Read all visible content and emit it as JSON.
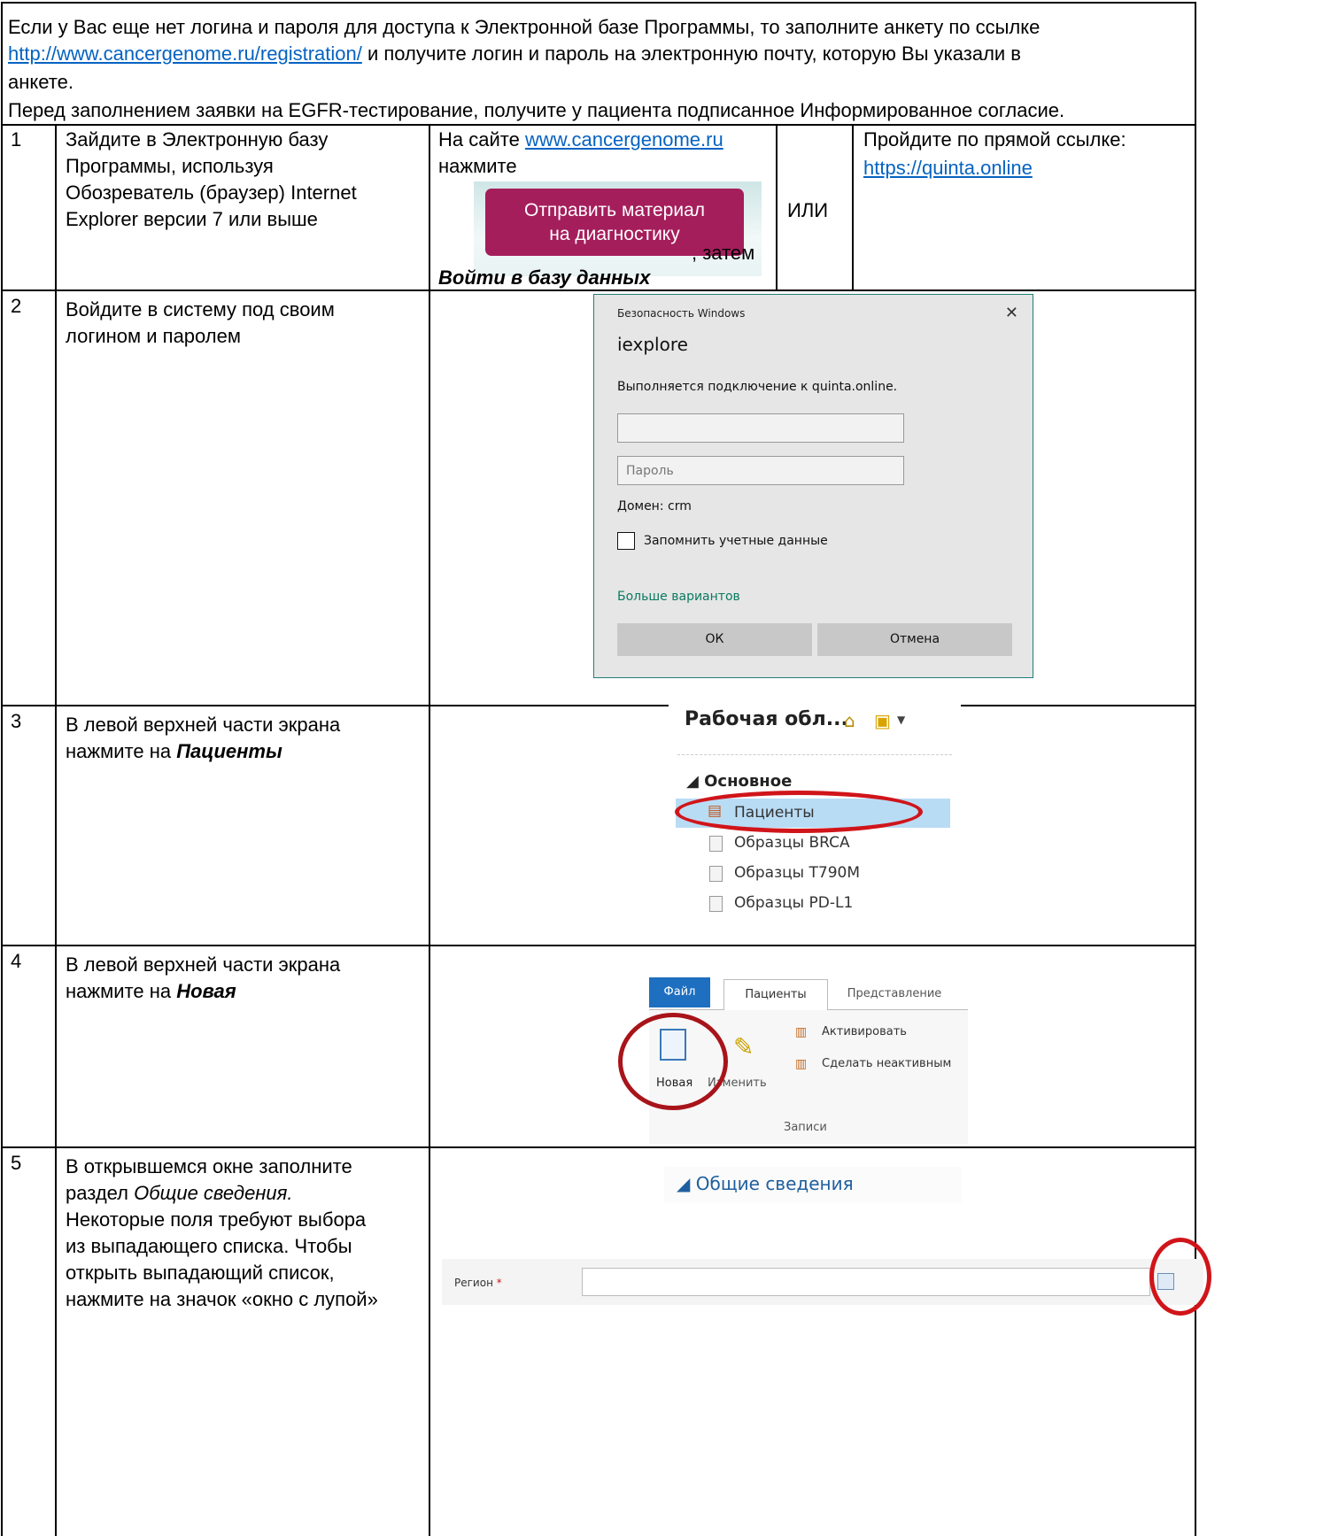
{
  "intro": {
    "line1": "Если у Вас еще нет логина и пароля для доступа к Электронной базе Программы, то заполните анкету по ссылке",
    "link": "http://www.cancergenome.ru/registration/",
    "line2_rest": " и получите логин и пароль на электронную почту, которую Вы указали в",
    "line3": "анкете.",
    "line4": "Перед заполнением заявки на EGFR-тестирование, получите у пациента подписанное Информированное согласие."
  },
  "rows": [
    {
      "num": "1",
      "text_lines": [
        "Зайдите в Электронную базу",
        "Программы, используя",
        "Обозреватель (браузер) Internet",
        "Explorer версии 7 или выше"
      ]
    },
    {
      "num": "2",
      "text_lines": [
        "Войдите в систему под своим",
        "логином и паролем"
      ]
    },
    {
      "num": "3",
      "text_lines": [
        "В левой верхней части экрана",
        "нажмите на "
      ],
      "bold": "Пациенты"
    },
    {
      "num": "4",
      "text_lines": [
        "В левой верхней части экрана",
        "нажмите на "
      ],
      "bold": "Новая"
    },
    {
      "num": "5",
      "text_lines": [
        "В открывшемся окне заполните",
        "раздел ",
        "Некоторые поля требуют выбора",
        "из выпадающего списка. Чтобы",
        "открыть выпадающий список,",
        "нажмите на значок «окно с лупой»"
      ],
      "italic": "Общие сведения."
    }
  ],
  "step1": {
    "site_prefix": "На сайте ",
    "site_link": "www.cancergenome.ru",
    "press": "нажмите",
    "button_line1": "Отправить материал",
    "button_line2": "на диагностику",
    "then": ", затем",
    "login_bold": "Войти в базу данных",
    "or": "ИЛИ",
    "direct": "Пройдите по прямой ссылке:",
    "direct_link": "https://quinta.online"
  },
  "dialog": {
    "title": "Безопасность Windows",
    "close": "✕",
    "app": "iexplore",
    "connecting": "Выполняется подключение к quinta.online.",
    "password_placeholder": "Пароль",
    "domain": "Домен: crm",
    "remember": "Запомнить учетные данные",
    "more": "Больше вариантов",
    "ok": "ОК",
    "cancel": "Отмена"
  },
  "crm_nav": {
    "title": "Рабочая обл...",
    "section": "◢ Основное",
    "items": [
      "Пациенты",
      "Образцы BRCA",
      "Образцы T790M",
      "Образцы PD-L1"
    ]
  },
  "ribbon": {
    "file": "Файл",
    "tab_active": "Пациенты",
    "tab_view": "Представление",
    "activate": "Активировать",
    "deactivate": "Сделать неактивным",
    "new": "Новая",
    "edit": "Изменить",
    "group": "Записи"
  },
  "form": {
    "section": "◢ Общие сведения",
    "region_label": "Регион",
    "required": "*"
  }
}
